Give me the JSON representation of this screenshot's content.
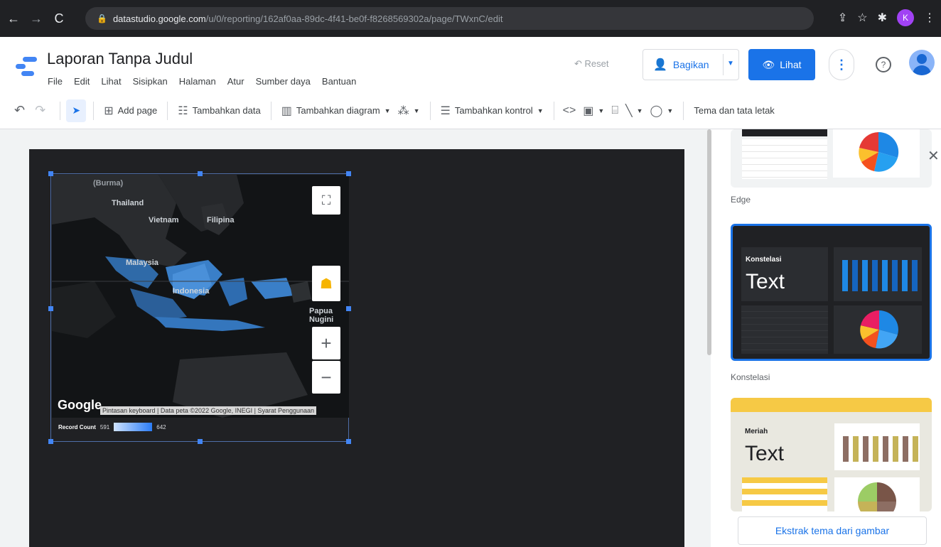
{
  "browser": {
    "url_host": "datastudio.google.com",
    "url_path": "/u/0/reporting/162af0aa-89dc-4f41-be0f-f8268569302a/page/TWxnC/edit",
    "profile_initial": "K"
  },
  "app": {
    "title": "Laporan Tanpa Judul",
    "menu": [
      "File",
      "Edit",
      "Lihat",
      "Sisipkan",
      "Halaman",
      "Atur",
      "Sumber daya",
      "Bantuan"
    ],
    "reset_label": "Reset",
    "share_label": "Bagikan",
    "view_label": "Lihat"
  },
  "toolbar": {
    "add_page": "Add page",
    "add_data": "Tambahkan data",
    "add_chart": "Tambahkan diagram",
    "add_control": "Tambahkan kontrol",
    "theme_layout": "Tema dan tata letak"
  },
  "map": {
    "labels": [
      "(Burma)",
      "Thailand",
      "Vietnam",
      "Filipina",
      "Malaysia",
      "Indonesia",
      "Papua Nugini"
    ],
    "google": "Google",
    "attribution": "Pintasan keyboard | Data peta ©2022 Google, INEGI | Syarat Penggunaan",
    "legend_title": "Record Count",
    "legend_min": "591",
    "legend_max": "642"
  },
  "themes": {
    "edge_label": "Edge",
    "konstelasi_title": "Konstelasi",
    "konstelasi_text": "Text",
    "konstelasi_label": "Konstelasi",
    "meriah_title": "Meriah",
    "meriah_text": "Text",
    "extract_label": "Ekstrak tema dari gambar"
  },
  "colors": {
    "primary": "#1a73e8",
    "report_bg": "#202124",
    "konstelasi_accent": "#1e88e5",
    "meriah_accent": "#f6c945"
  }
}
